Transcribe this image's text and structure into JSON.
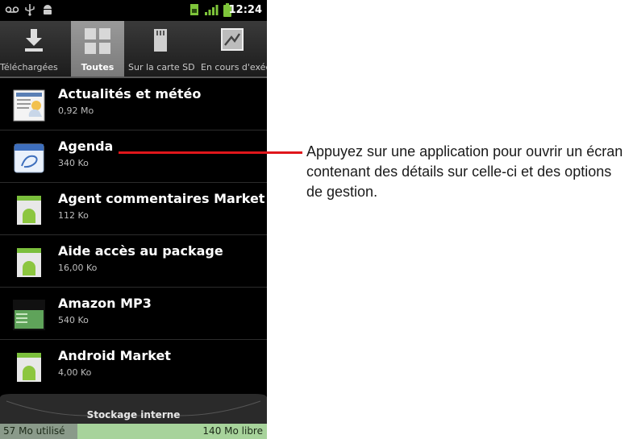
{
  "status_bar": {
    "time": "12:24",
    "icons": [
      "voicemail-icon",
      "usb-icon",
      "android-debug-icon",
      "sim-icon",
      "signal-icon",
      "battery-icon"
    ]
  },
  "tabs": [
    {
      "label": "Téléchargées",
      "icon": "download-icon",
      "active": false
    },
    {
      "label": "Toutes",
      "icon": "grid-icon",
      "active": true
    },
    {
      "label": "Sur la carte SD",
      "icon": "sd-card-icon",
      "active": false
    },
    {
      "label": "En cours d'exécution",
      "icon": "running-apps-icon",
      "active": false
    }
  ],
  "apps": [
    {
      "name": "Actualités et météo",
      "size": "0,92 Mo",
      "icon": "news-weather-icon"
    },
    {
      "name": "Agenda",
      "size": "340 Ko",
      "icon": "calendar-icon"
    },
    {
      "name": "Agent commentaires Market",
      "size": "112 Ko",
      "icon": "android-app-icon"
    },
    {
      "name": "Aide accès au package",
      "size": "16,00 Ko",
      "icon": "android-app-icon"
    },
    {
      "name": "Amazon MP3",
      "size": "540 Ko",
      "icon": "amazon-mp3-icon"
    },
    {
      "name": "Android Market",
      "size": "4,00 Ko",
      "icon": "android-app-icon"
    }
  ],
  "storage": {
    "label": "Stockage interne",
    "used": "57 Mo utilisé",
    "free": "140 Mo libre",
    "used_fraction": 0.29
  },
  "callout": {
    "text": "Appuyez sur une application pour ouvrir un écran contenant des détails sur celle-ci et des options de gestion."
  },
  "colors": {
    "callout_line": "#e0161b",
    "storage_free": "#a7d39b",
    "storage_used": "#8a9a8a",
    "active_tab": "#8a8a8a"
  }
}
